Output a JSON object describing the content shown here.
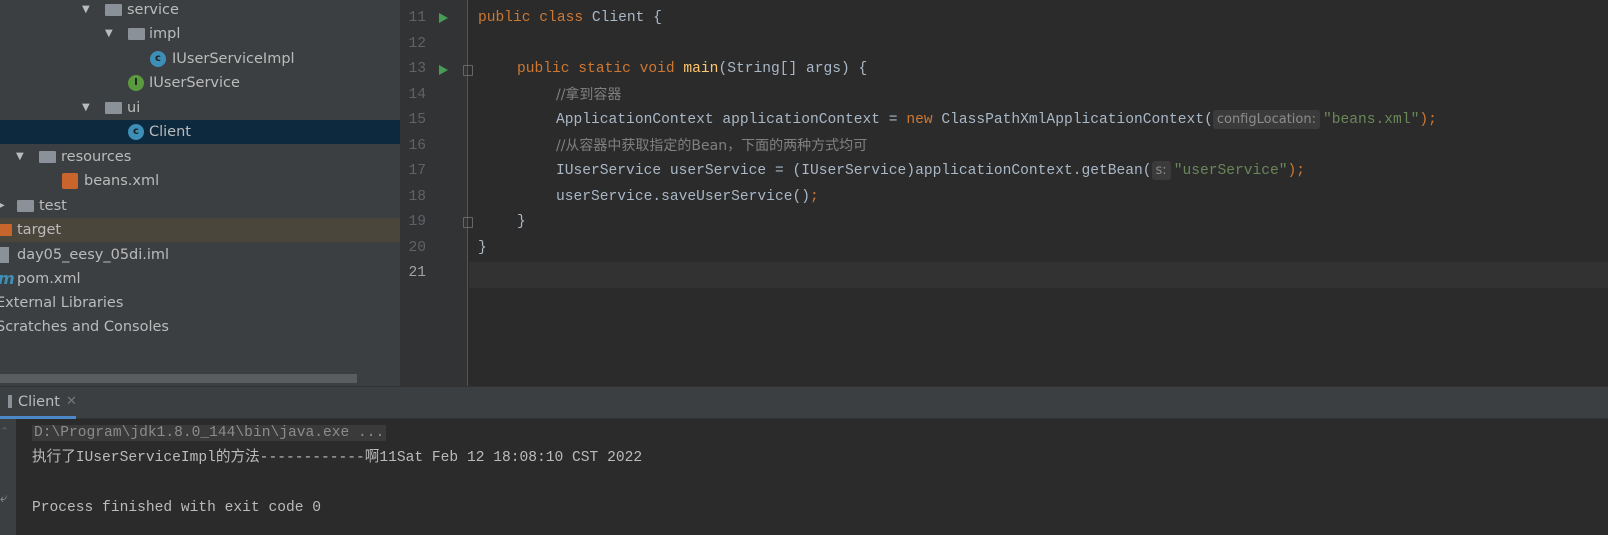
{
  "project_tree": {
    "items": [
      {
        "label": "service",
        "icon": "package-folder-icon"
      },
      {
        "label": "impl",
        "icon": "package-folder-icon"
      },
      {
        "label": "IUserServiceImpl",
        "icon": "class-icon"
      },
      {
        "label": "IUserService",
        "icon": "interface-icon"
      },
      {
        "label": "ui",
        "icon": "package-folder-icon"
      },
      {
        "label": "Client",
        "icon": "runnable-class-icon",
        "selected": true
      },
      {
        "label": "resources",
        "icon": "resources-folder-icon"
      },
      {
        "label": "beans.xml",
        "icon": "spring-xml-icon"
      },
      {
        "label": "test",
        "icon": "folder-icon"
      },
      {
        "label": "target",
        "icon": "excluded-folder-icon"
      },
      {
        "label": "day05_eesy_05di.iml",
        "icon": "iml-file-icon"
      },
      {
        "label": "pom.xml",
        "icon": "maven-icon"
      },
      {
        "label": "External Libraries",
        "icon": "library-icon"
      },
      {
        "label": "Scratches and Consoles",
        "icon": "scratches-icon"
      }
    ]
  },
  "editor": {
    "line_numbers": [
      "11",
      "12",
      "13",
      "14",
      "15",
      "16",
      "17",
      "18",
      "19",
      "20",
      "21"
    ],
    "lines": {
      "l11": {
        "kw": "public class ",
        "name": "Client {"
      },
      "l13": {
        "kw": "public static void ",
        "fn": "main",
        "rest": "(String[] args) {"
      },
      "l14": {
        "comment": "//拿到容器"
      },
      "l15": {
        "a": "ApplicationContext applicationContext = ",
        "kw": "new ",
        "b": "ClassPathXmlApplicationContext(",
        "hint": "configLocation:",
        "str": "\"beans.xml\"",
        "c": ");"
      },
      "l16": {
        "comment": "//从容器中获取指定的Bean，下面的两种方式均可"
      },
      "l17": {
        "a": "IUserService userService = (IUserService)applicationContext.getBean(",
        "hint": "s:",
        "str": "\"userService\"",
        "c": ");"
      },
      "l18": {
        "a": "userService.saveUserService()",
        "semi": ";"
      },
      "l19": {
        "a": "}"
      },
      "l20": {
        "a": "}"
      }
    }
  },
  "run_panel": {
    "tab_label": "Client",
    "console": {
      "command": "D:\\Program\\jdk1.8.0_144\\bin\\java.exe ...",
      "output": "执行了IUserServiceImpl的方法------------啊11Sat Feb 12 18:08:10 CST 2022",
      "exit": "Process finished with exit code 0"
    }
  },
  "colors": {
    "keyword": "#cc7832",
    "string": "#6a8759",
    "comment": "#808080",
    "function": "#ffc66d",
    "selection": "#0d293e"
  }
}
